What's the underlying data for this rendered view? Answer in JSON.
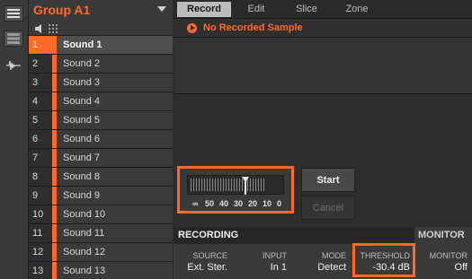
{
  "group": {
    "name": "Group A1"
  },
  "sounds": [
    {
      "num": "1",
      "name": "Sound 1"
    },
    {
      "num": "2",
      "name": "Sound 2"
    },
    {
      "num": "3",
      "name": "Sound 3"
    },
    {
      "num": "4",
      "name": "Sound 4"
    },
    {
      "num": "5",
      "name": "Sound 5"
    },
    {
      "num": "6",
      "name": "Sound 6"
    },
    {
      "num": "7",
      "name": "Sound 7"
    },
    {
      "num": "8",
      "name": "Sound 8"
    },
    {
      "num": "9",
      "name": "Sound 9"
    },
    {
      "num": "10",
      "name": "Sound 10"
    },
    {
      "num": "11",
      "name": "Sound 11"
    },
    {
      "num": "12",
      "name": "Sound 12"
    },
    {
      "num": "13",
      "name": "Sound 13"
    }
  ],
  "selected_sound": "1",
  "tabs": [
    "Record",
    "Edit",
    "Slice",
    "Zone"
  ],
  "active_tab": "Record",
  "status": {
    "text": "No Recorded Sample",
    "icon": "play-icon"
  },
  "meter": {
    "scale": [
      "∞",
      "50",
      "40",
      "30",
      "20",
      "10",
      "0"
    ]
  },
  "buttons": {
    "start": "Start",
    "cancel": "Cancel"
  },
  "recording": {
    "header": "RECORDING",
    "monitor_header": "MONITOR"
  },
  "params": {
    "source": {
      "label": "SOURCE",
      "value": "Ext. Ster."
    },
    "input": {
      "label": "INPUT",
      "value": "In 1"
    },
    "mode": {
      "label": "MODE",
      "value": "Detect"
    },
    "threshold": {
      "label": "THRESHOLD",
      "value": "-30.4 dB"
    },
    "monitor": {
      "label": "MONITOR",
      "value": "Off"
    }
  },
  "colors": {
    "accent": "#ff6a2b",
    "highlight": "#ff6a2b",
    "panel": "#2d2d2d"
  }
}
